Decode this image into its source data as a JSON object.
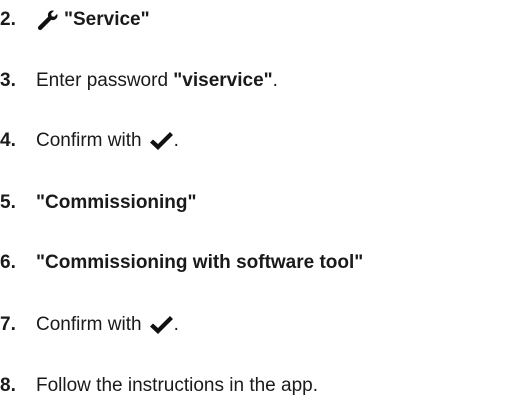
{
  "steps": [
    {
      "num": "2.",
      "icon": "wrench-icon",
      "bold": "\"Service\""
    },
    {
      "num": "3.",
      "text": "Enter password ",
      "bold": "\"viservice\"",
      "after": "."
    },
    {
      "num": "4.",
      "text": "Confirm with ",
      "icon": "check-icon",
      "after": "."
    },
    {
      "num": "5.",
      "bold": "\"Commissioning\""
    },
    {
      "num": "6.",
      "bold": "\"Commissioning with software tool\""
    },
    {
      "num": "7.",
      "text": "Confirm with ",
      "icon": "check-icon",
      "after": "."
    },
    {
      "num": "8.",
      "text": "Follow the instructions in the app."
    }
  ]
}
